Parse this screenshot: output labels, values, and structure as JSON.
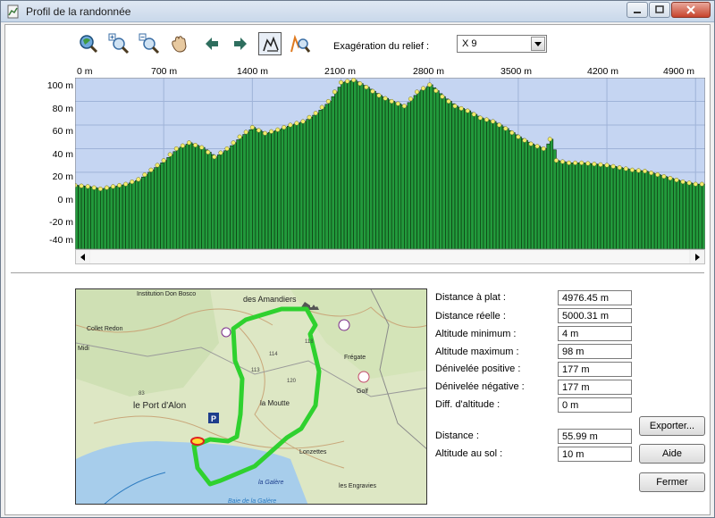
{
  "window": {
    "title": "Profil de la randonnée",
    "controls": [
      "minimize",
      "maximize",
      "close"
    ]
  },
  "toolbar": {
    "tools": [
      {
        "name": "zoom-extent-icon"
      },
      {
        "name": "zoom-in-icon"
      },
      {
        "name": "zoom-out-icon"
      },
      {
        "name": "pan-hand-icon"
      },
      {
        "name": "arrow-left-icon"
      },
      {
        "name": "arrow-right-icon"
      },
      {
        "name": "profile-mode-icon",
        "active": true
      },
      {
        "name": "zoom-profile-icon"
      }
    ],
    "exaggeration_label": "Exagération du relief :",
    "exaggeration_value": "X 9"
  },
  "chart_data": {
    "type": "area",
    "x_ticks": [
      "0 m",
      "700 m",
      "1400 m",
      "2100 m",
      "2800 m",
      "3500 m",
      "4200 m",
      "4900 m"
    ],
    "y_ticks": [
      "100 m",
      "80 m",
      "60 m",
      "40 m",
      "20 m",
      "0 m",
      "-20 m",
      "-40 m"
    ],
    "xlim": [
      0,
      4976
    ],
    "ylim": [
      -45,
      100
    ],
    "grid": true,
    "colors": {
      "background": "#c5d5f2",
      "fill": "#229a3c",
      "stroke": "#0a2d0a",
      "point": "#f2ec6c"
    },
    "x": [
      0,
      100,
      200,
      300,
      400,
      500,
      600,
      700,
      800,
      900,
      1000,
      1100,
      1200,
      1300,
      1400,
      1500,
      1600,
      1700,
      1800,
      1900,
      2000,
      2100,
      2200,
      2300,
      2400,
      2500,
      2600,
      2700,
      2800,
      2900,
      3000,
      3100,
      3200,
      3300,
      3400,
      3500,
      3600,
      3700,
      3750,
      3800,
      3900,
      4000,
      4100,
      4200,
      4300,
      4400,
      4500,
      4600,
      4700,
      4800,
      4900,
      4976
    ],
    "y": [
      9,
      8,
      6,
      8,
      10,
      14,
      22,
      30,
      40,
      45,
      41,
      33,
      40,
      50,
      58,
      53,
      56,
      60,
      63,
      70,
      80,
      96,
      98,
      92,
      85,
      80,
      76,
      88,
      94,
      84,
      76,
      72,
      66,
      63,
      57,
      50,
      44,
      40,
      48,
      30,
      28,
      28,
      27,
      26,
      24,
      22,
      21,
      18,
      15,
      12,
      10,
      10
    ]
  },
  "stats": [
    {
      "label": "Distance à plat :",
      "value": "4976.45 m"
    },
    {
      "label": "Distance réelle :",
      "value": "5000.31 m"
    },
    {
      "label": "Altitude minimum :",
      "value": "4 m"
    },
    {
      "label": "Altitude maximum :",
      "value": "98 m"
    },
    {
      "label": "Dénivelée positive :",
      "value": "177 m"
    },
    {
      "label": "Dénivelée négative :",
      "value": "177 m"
    },
    {
      "label": "Diff. d'altitude :",
      "value": "0 m"
    }
  ],
  "cursor_stats": [
    {
      "label": "Distance :",
      "value": "55.99 m"
    },
    {
      "label": "Altitude au sol :",
      "value": "10 m"
    }
  ],
  "buttons": {
    "export": "Exporter...",
    "help": "Aide",
    "close": "Fermer"
  },
  "map": {
    "labels": [
      "des Amandiers",
      "Institution Don Bosco",
      "Collet Redon",
      "Midi",
      "le Port d'Alon",
      "la Moutte",
      "Frégate",
      "Golf",
      "la Galère",
      "Baie de la Galère",
      "les Engravies",
      "Lonzettes",
      "P",
      "114",
      "120",
      "113",
      "118",
      "83"
    ],
    "colors": {
      "track": "#2fd12f",
      "sea": "#a7cdeb",
      "land": "#dde7c4",
      "forest": "#bcd9a7"
    }
  }
}
